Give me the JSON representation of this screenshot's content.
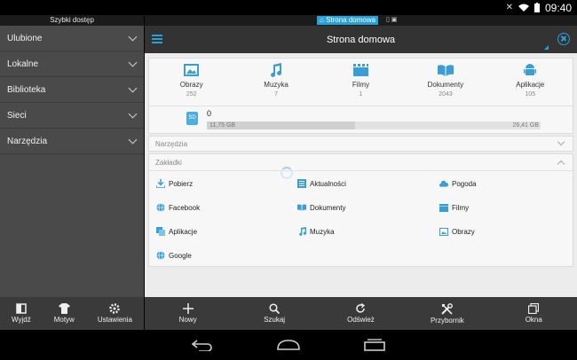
{
  "status_bar": {
    "time": "09:40"
  },
  "quick_access": {
    "header": "Szybki dostęp",
    "items": [
      {
        "label": "Ulubione"
      },
      {
        "label": "Lokalne"
      },
      {
        "label": "Biblioteka"
      },
      {
        "label": "Sieci"
      },
      {
        "label": "Narzędzia"
      }
    ],
    "bottom": [
      {
        "label": "Wyjdź",
        "icon": "exit-icon"
      },
      {
        "label": "Motyw",
        "icon": "shirt-icon"
      },
      {
        "label": "Ustawienia",
        "icon": "gear-icon"
      }
    ]
  },
  "tab": {
    "label": "Strona domowa",
    "icon": "home-icon"
  },
  "header": {
    "title": "Strona domowa"
  },
  "categories": [
    {
      "label": "Obrazy",
      "count": "252",
      "icon": "image-icon"
    },
    {
      "label": "Muzyka",
      "count": "7",
      "icon": "music-note-icon"
    },
    {
      "label": "Filmy",
      "count": "1",
      "icon": "film-icon"
    },
    {
      "label": "Dokumenty",
      "count": "2043",
      "icon": "book-icon"
    },
    {
      "label": "Aplikacje",
      "count": "105",
      "icon": "android-icon"
    }
  ],
  "storage": {
    "name": "0",
    "icon_label": "SD",
    "used": "11,75 GB",
    "total": "26,41 GB",
    "used_fraction": 0.445
  },
  "sections": {
    "tools": "Narzędzia",
    "bookmarks": "Zakładki"
  },
  "bookmarks": [
    {
      "label": "Pobierz",
      "icon": "download-icon"
    },
    {
      "label": "Aktualności",
      "icon": "news-icon"
    },
    {
      "label": "Pogoda",
      "icon": "weather-icon"
    },
    {
      "label": "Facebook",
      "icon": "globe-icon"
    },
    {
      "label": "Dokumenty",
      "icon": "book-icon"
    },
    {
      "label": "Filmy",
      "icon": "film-icon"
    },
    {
      "label": "Aplikacje",
      "icon": "apps-icon"
    },
    {
      "label": "Muzyka",
      "icon": "music-note-icon"
    },
    {
      "label": "Obrazy",
      "icon": "image-icon"
    },
    {
      "label": "Google",
      "icon": "globe-icon"
    }
  ],
  "toolbar": [
    {
      "label": "Nowy",
      "icon": "plus-icon"
    },
    {
      "label": "Szukaj",
      "icon": "search-icon"
    },
    {
      "label": "Odśwież",
      "icon": "refresh-icon"
    },
    {
      "label": "Przybornik",
      "icon": "tools-icon"
    },
    {
      "label": "Okna",
      "icon": "windows-icon"
    }
  ],
  "colors": {
    "accent": "#2aa0d8",
    "panel_dark": "#4a4a4a",
    "toolbar": "#3a3a3a"
  }
}
